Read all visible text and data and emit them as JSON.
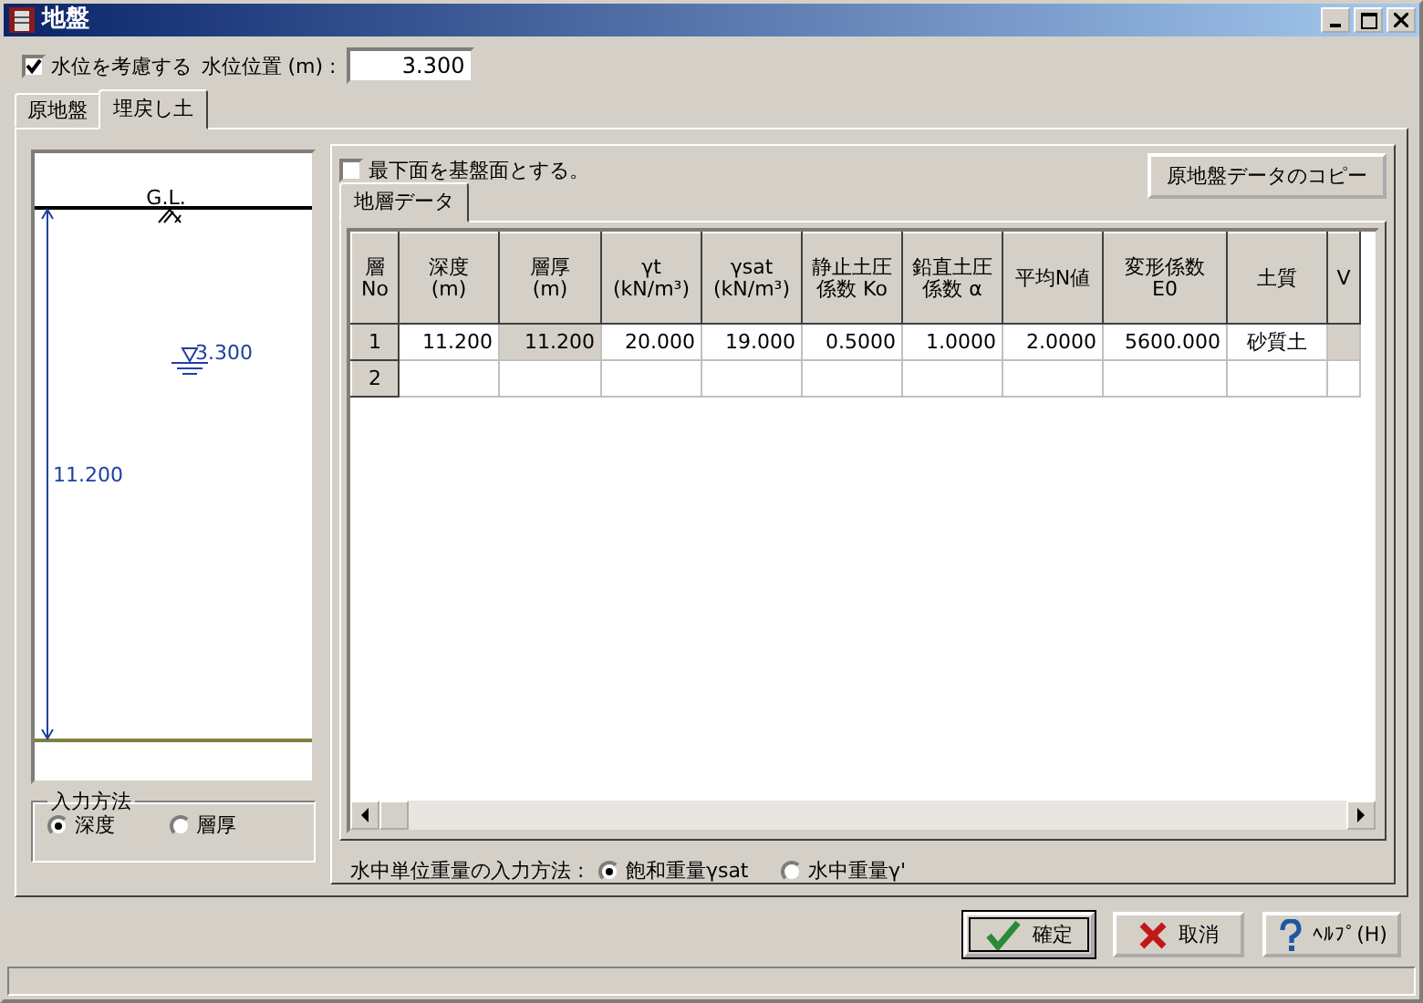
{
  "window": {
    "title": "地盤"
  },
  "water_level": {
    "label": "水位を考慮する",
    "checked": true,
    "position_label": "水位位置 (m) :",
    "value": "3.300"
  },
  "tabs": [
    {
      "label": "原地盤",
      "selected": false
    },
    {
      "label": "埋戻し土",
      "selected": true
    }
  ],
  "diagram": {
    "gl_label": "G.L.",
    "water_label": "3.300",
    "depth_label": "11.200"
  },
  "input_method": {
    "legend": "入力方法",
    "options": [
      {
        "label": "深度",
        "selected": true
      },
      {
        "label": "層厚",
        "selected": false
      }
    ]
  },
  "base_checkbox": {
    "label": "最下面を基盤面とする。",
    "checked": false
  },
  "copy_button": "原地盤データのコピー",
  "inner_tabs": [
    {
      "label": "地層データ",
      "selected": true
    }
  ],
  "table": {
    "columns": [
      {
        "lines": [
          "層",
          "No"
        ]
      },
      {
        "lines": [
          "深度",
          "(m)"
        ]
      },
      {
        "lines": [
          "層厚",
          "(m)"
        ]
      },
      {
        "lines": [
          "γt",
          "(kN/m³)"
        ]
      },
      {
        "lines": [
          "γsat",
          "(kN/m³)"
        ]
      },
      {
        "lines": [
          "静止土圧",
          "係数 Ko"
        ]
      },
      {
        "lines": [
          "鉛直土圧",
          "係数 α"
        ]
      },
      {
        "lines": [
          "平均N値"
        ]
      },
      {
        "lines": [
          "変形係数",
          "E0"
        ]
      },
      {
        "lines": [
          "土質"
        ]
      },
      {
        "lines": [
          "V"
        ]
      }
    ],
    "rows": [
      {
        "header": "1",
        "cells": [
          {
            "text": "11.200",
            "shaded": false
          },
          {
            "text": "11.200",
            "shaded": true
          },
          {
            "text": "20.000",
            "shaded": false
          },
          {
            "text": "19.000",
            "shaded": false
          },
          {
            "text": "0.5000",
            "shaded": false
          },
          {
            "text": "1.0000",
            "shaded": false
          },
          {
            "text": "2.0000",
            "shaded": false
          },
          {
            "text": "5600.000",
            "shaded": false
          },
          {
            "text": "砂質土",
            "shaded": false
          },
          {
            "shaded": true
          }
        ]
      },
      {
        "header": "2"
      }
    ]
  },
  "unit_weight": {
    "label": "水中単位重量の入力方法 :",
    "options": [
      {
        "label": "飽和重量γsat",
        "selected": true
      },
      {
        "label": "水中重量γ'",
        "selected": false
      }
    ]
  },
  "buttons": [
    {
      "label": "確定",
      "kind": "ok",
      "focused": true
    },
    {
      "label": "取消",
      "kind": "cancel",
      "focused": false
    },
    {
      "label": "ﾍﾙﾌﾟ(H)",
      "kind": "help",
      "focused": false
    }
  ]
}
